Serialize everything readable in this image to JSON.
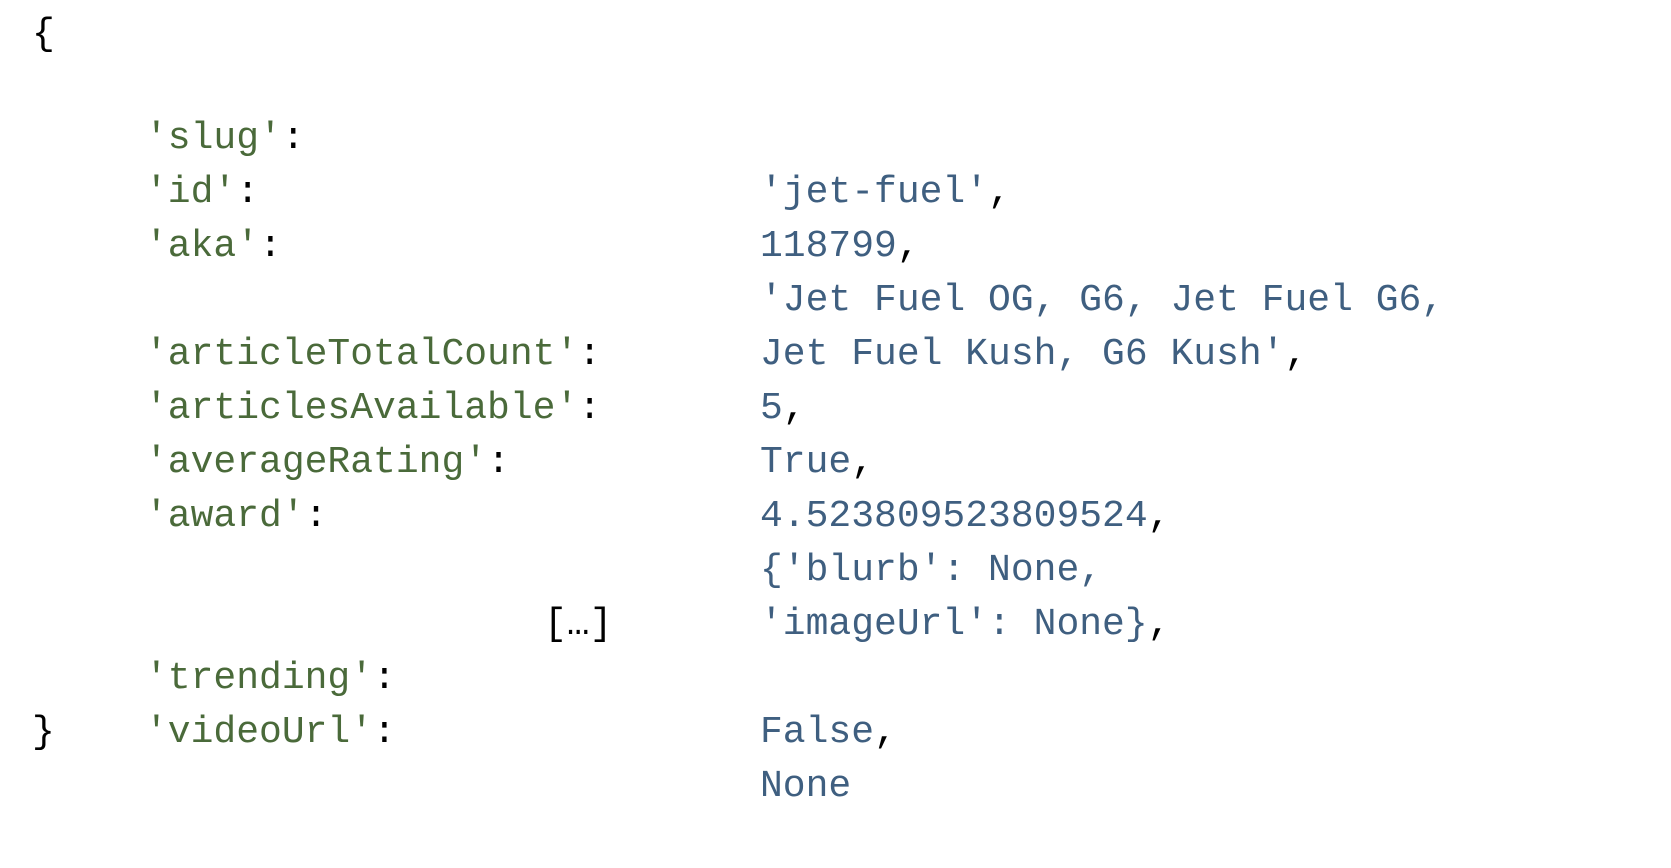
{
  "open_brace": "{",
  "close_brace": "}",
  "ellipsis": "[…]",
  "entries": [
    {
      "key": "'slug'",
      "colon": ":",
      "value": "'jet-fuel'",
      "comma": ","
    },
    {
      "key": "'id'",
      "colon": ":",
      "value": "118799",
      "comma": ","
    },
    {
      "key": "'aka'",
      "colon": ":",
      "value": "'Jet Fuel OG, G6, Jet Fuel G6,",
      "comma": ""
    },
    {
      "key": "",
      "colon": "",
      "value": "Jet Fuel Kush, G6 Kush'",
      "comma": ","
    },
    {
      "key": "'articleTotalCount'",
      "colon": ":",
      "value": "5",
      "comma": ","
    },
    {
      "key": "'articlesAvailable'",
      "colon": ":",
      "value": "True",
      "comma": ","
    },
    {
      "key": "'averageRating'",
      "colon": ":",
      "value": "4.523809523809524",
      "comma": ","
    },
    {
      "key": "'award'",
      "colon": ":",
      "value": "{'blurb': None,",
      "comma": ""
    },
    {
      "key": "",
      "colon": "",
      "value": "'imageUrl': None}",
      "comma": ","
    },
    {
      "key": "'trending'",
      "colon": ":",
      "value": "False",
      "comma": ","
    },
    {
      "key": "'videoUrl'",
      "colon": ":",
      "value": "None",
      "comma": ""
    }
  ],
  "colors": {
    "key": "#4a6a3a",
    "value": "#3f5f80",
    "punctuation": "#000000"
  }
}
